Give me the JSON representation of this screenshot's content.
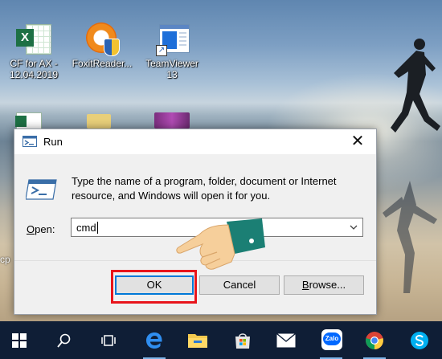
{
  "desktop": {
    "icons": [
      {
        "label_line1": "CF for AX -",
        "label_line2": "12.04.2019",
        "icon": "excel-file-icon"
      },
      {
        "label_line1": "FoxitReader...",
        "label_line2": "",
        "icon": "foxit-reader-icon"
      },
      {
        "label_line1": "TeamViewer",
        "label_line2": "13",
        "icon": "teamviewer-shortcut-icon"
      }
    ],
    "partial_label": "cp"
  },
  "dialog": {
    "title": "Run",
    "description": "Type the name of a program, folder, document or Internet resource, and Windows will open it for you.",
    "open_label_prefix": "O",
    "open_label_rest": "pen:",
    "command_value": "cmd",
    "buttons": {
      "ok": "OK",
      "cancel": "Cancel",
      "browse": "Browse..."
    }
  },
  "taskbar": {
    "items": [
      "start-icon",
      "search-icon",
      "task-view-icon",
      "edge-icon",
      "file-explorer-icon",
      "store-icon",
      "mail-icon",
      "zalo-icon",
      "chrome-icon",
      "skype-icon"
    ],
    "zalo_text": "Zalo"
  },
  "colors": {
    "highlight": "#e8141b",
    "ok_border": "#0078d7",
    "taskbar": "#0f1e36"
  }
}
